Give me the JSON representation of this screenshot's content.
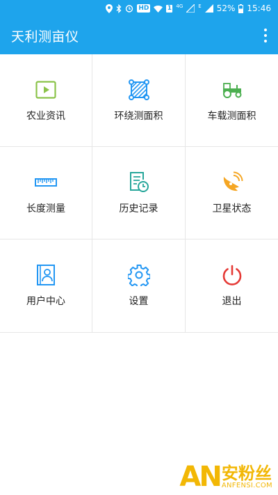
{
  "status_bar": {
    "hd_badge": "HD",
    "sim_badge": "1",
    "network_4g": "4G",
    "network_e": "E",
    "battery": "52%",
    "time": "15:46",
    "icons": [
      "location-icon",
      "bluetooth-icon",
      "alarm-icon",
      "wifi-icon",
      "signal-icon",
      "battery-icon"
    ]
  },
  "app_bar": {
    "title": "天利测亩仪",
    "menu_icon": "more-vert-icon",
    "color": "#1ea4ec"
  },
  "grid": {
    "items": [
      {
        "label": "农业资讯",
        "icon": "video-news-icon",
        "color": "#8bc34a"
      },
      {
        "label": "环绕测面积",
        "icon": "area-polygon-icon",
        "color": "#2196f3"
      },
      {
        "label": "车载测面积",
        "icon": "tractor-icon",
        "color": "#4caf50"
      },
      {
        "label": "长度测量",
        "icon": "ruler-icon",
        "color": "#2196f3"
      },
      {
        "label": "历史记录",
        "icon": "history-doc-icon",
        "color": "#26a69a"
      },
      {
        "label": "卫星状态",
        "icon": "satellite-dish-icon",
        "color": "#f5a623"
      },
      {
        "label": "用户中心",
        "icon": "user-contact-icon",
        "color": "#2196f3"
      },
      {
        "label": "设置",
        "icon": "gear-icon",
        "color": "#2196f3"
      },
      {
        "label": "退出",
        "icon": "power-icon",
        "color": "#e53935"
      }
    ]
  },
  "watermark": {
    "logo": "AN",
    "text_cn": "安粉丝",
    "text_en": "ANFENSI.COM"
  }
}
